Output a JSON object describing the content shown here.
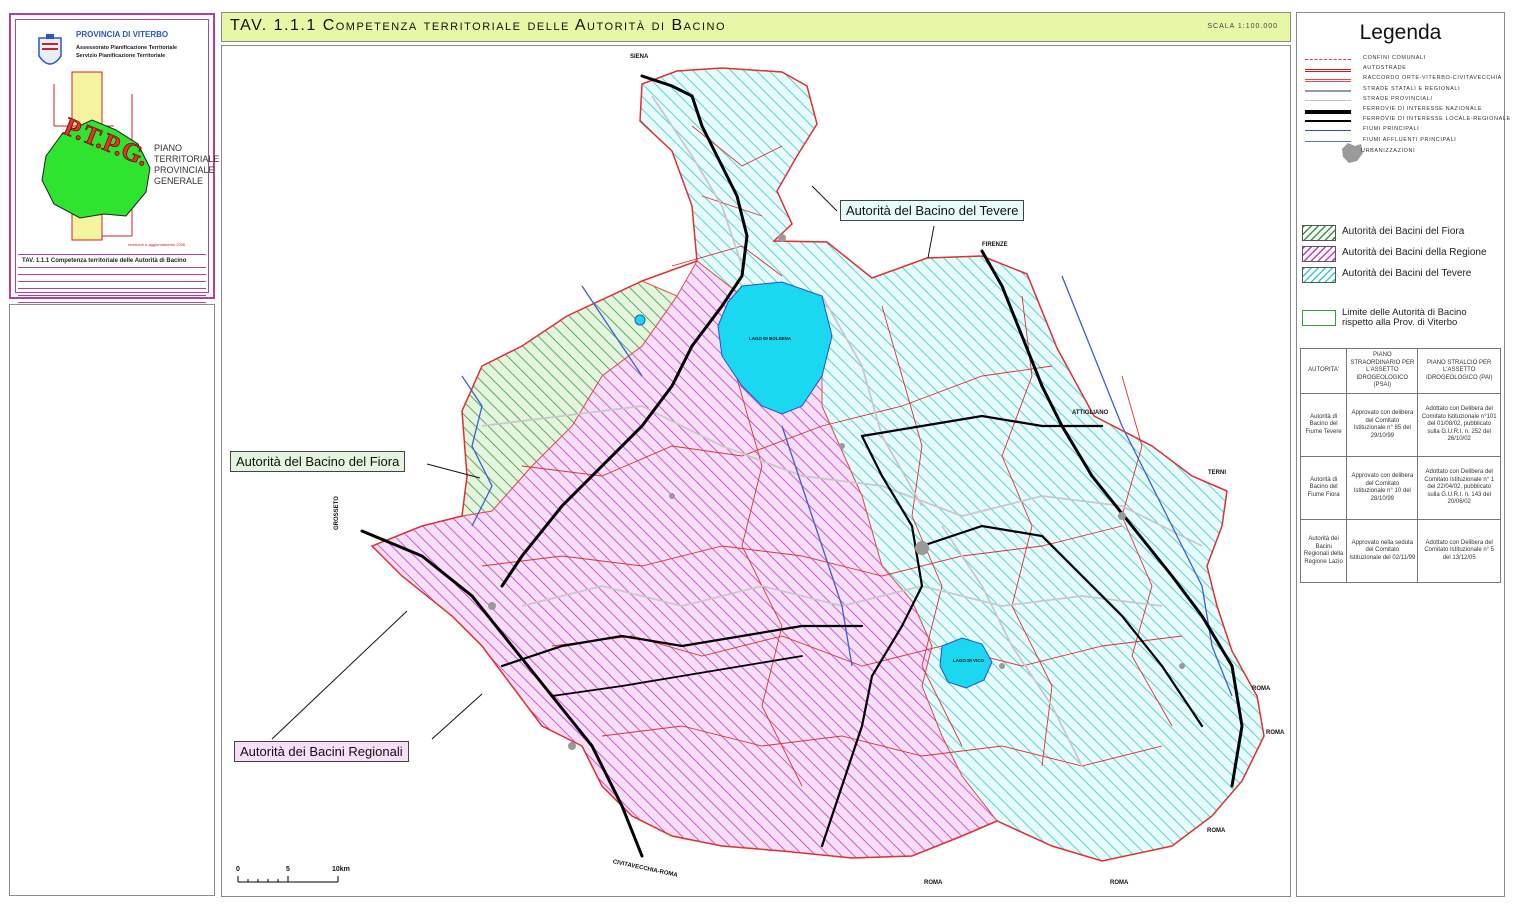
{
  "title_block": {
    "provincia": "PROVINCIA DI VITERBO",
    "assessorato": "Assessorato Pianificazione Territoriale",
    "servizio": "Servizio Pianificazione Territoriale",
    "logo_letters": "P.T.P.G.",
    "piano_lines": [
      "PIANO",
      "TERRITORIALE",
      "PROVINCIALE",
      "GENERALE"
    ],
    "revision": "revisione e aggiornamento 2006",
    "tav_label": "TAV. 1.1.1 Competenza territoriale delle Autorità di Bacino"
  },
  "header": {
    "title": "TAV. 1.1.1 Competenza territoriale delle Autorità di Bacino",
    "scale": "SCALA 1:100.000"
  },
  "legend": {
    "title": "Legenda",
    "line_items": [
      {
        "label": "CONFINI COMUNALI",
        "color": "#d23a3a",
        "style": "dashdot",
        "width": 1
      },
      {
        "label": "AUTOSTRADE",
        "color": "#d11a1a",
        "style": "double",
        "width": 2
      },
      {
        "label": "RACCORDO ORTE-VITERBO-CIVITAVECCHIA",
        "color": "#e24a4a",
        "style": "double",
        "width": 2
      },
      {
        "label": "STRADE STATALI E REGIONALI",
        "color": "#999999",
        "style": "solid",
        "width": 2
      },
      {
        "label": "STRADE PROVINCIALI",
        "color": "#c4c4c4",
        "style": "solid",
        "width": 1.5
      },
      {
        "label": "FERROVIE DI INTERESSE NAZIONALE",
        "color": "#000000",
        "style": "solid",
        "width": 4
      },
      {
        "label": "FERROVIE DI INTERESSE LOCALE-REGIONALE",
        "color": "#000000",
        "style": "solid",
        "width": 2
      },
      {
        "label": "FIUMI PRINCIPALI",
        "color": "#2a4fd0",
        "style": "solid",
        "width": 1.5
      },
      {
        "label": "FIUMI AFFLUENTI PRINCIPALI",
        "color": "#4a7ae0",
        "style": "solid",
        "width": 1
      }
    ],
    "urban_label": "URBANIZZAZIONI",
    "authorities": [
      {
        "label": "Autorità dei Bacini del Fiora",
        "color": "#3a9a3a"
      },
      {
        "label": "Autorità dei Bacini della Regione",
        "color": "#c23ac2"
      },
      {
        "label": "Autorità dei Bacini del Tevere",
        "color": "#38c8c8"
      }
    ],
    "limit_label_1": "Limite delle Autorità di Bacino",
    "limit_label_2": "rispetto alla Prov. di Viterbo",
    "table": {
      "headers": [
        "AUTORITA'",
        "PIANO STRAORDINARIO PER L'ASSETTO IDROGEOLOGICO (PSAI)",
        "PIANO STRALCIO PER L'ASSETTO IDROGEOLOGICO (PAI)"
      ],
      "rows": [
        [
          "Autorità di Bacino del Fiume Tevere",
          "Approvato con delibera del Comitato Istituzionale n° 85 del 29/10/99",
          "Adottato con Delibera del Comitato Istituzionale n°101 del 01/08/02, pubblicato sulla G.U.R.I. n. 252 del 26/10/02"
        ],
        [
          "Autorità di Bacino del Fiume Fiora",
          "Approvato con delibera del Comitato Istituzionale n° 10 del 28/10/99",
          "Adottato con Delibera del Comitato Istituzionale n° 1 del 22/04/02, pubblicato sulla G.U.R.I. n. 143 del 20/06/02"
        ],
        [
          "Autorità dei Bacini Regionali della Regione Lazio",
          "Approvato nella seduta del Comitato Istituzionale del 02/11/99",
          "Adottato con Delibera del Comitato Istituzionale n° 5 del 13/12/05"
        ]
      ]
    }
  },
  "map": {
    "callouts": {
      "tevere": "Autorità del Bacino del Tevere",
      "fiora": "Autorità del Bacino del Fiora",
      "regionali": "Autorità dei Bacini Regionali"
    },
    "places": {
      "siena": "SIENA",
      "firenze": "FIRENZE",
      "attigliano": "ATTIGLIANO",
      "terni": "TERNI",
      "grosseto": "GROSSETO",
      "roma1": "ROMA",
      "roma2": "ROMA",
      "roma3": "ROMA",
      "roma4": "ROMA",
      "roma5": "ROMA",
      "civitavecchia": "CIVITAVECCHIA-ROMA",
      "lago_bolsena": "LAGO DI BOLSENA",
      "lago_vico": "LAGO DI VICO"
    },
    "scale_bar": {
      "t0": "0",
      "t5": "5",
      "t10": "10km"
    },
    "colors": {
      "tevere": "#38c8c8",
      "regione": "#c23ac2",
      "fiora": "#3a9a3a",
      "lake": "#19d8f0"
    }
  }
}
